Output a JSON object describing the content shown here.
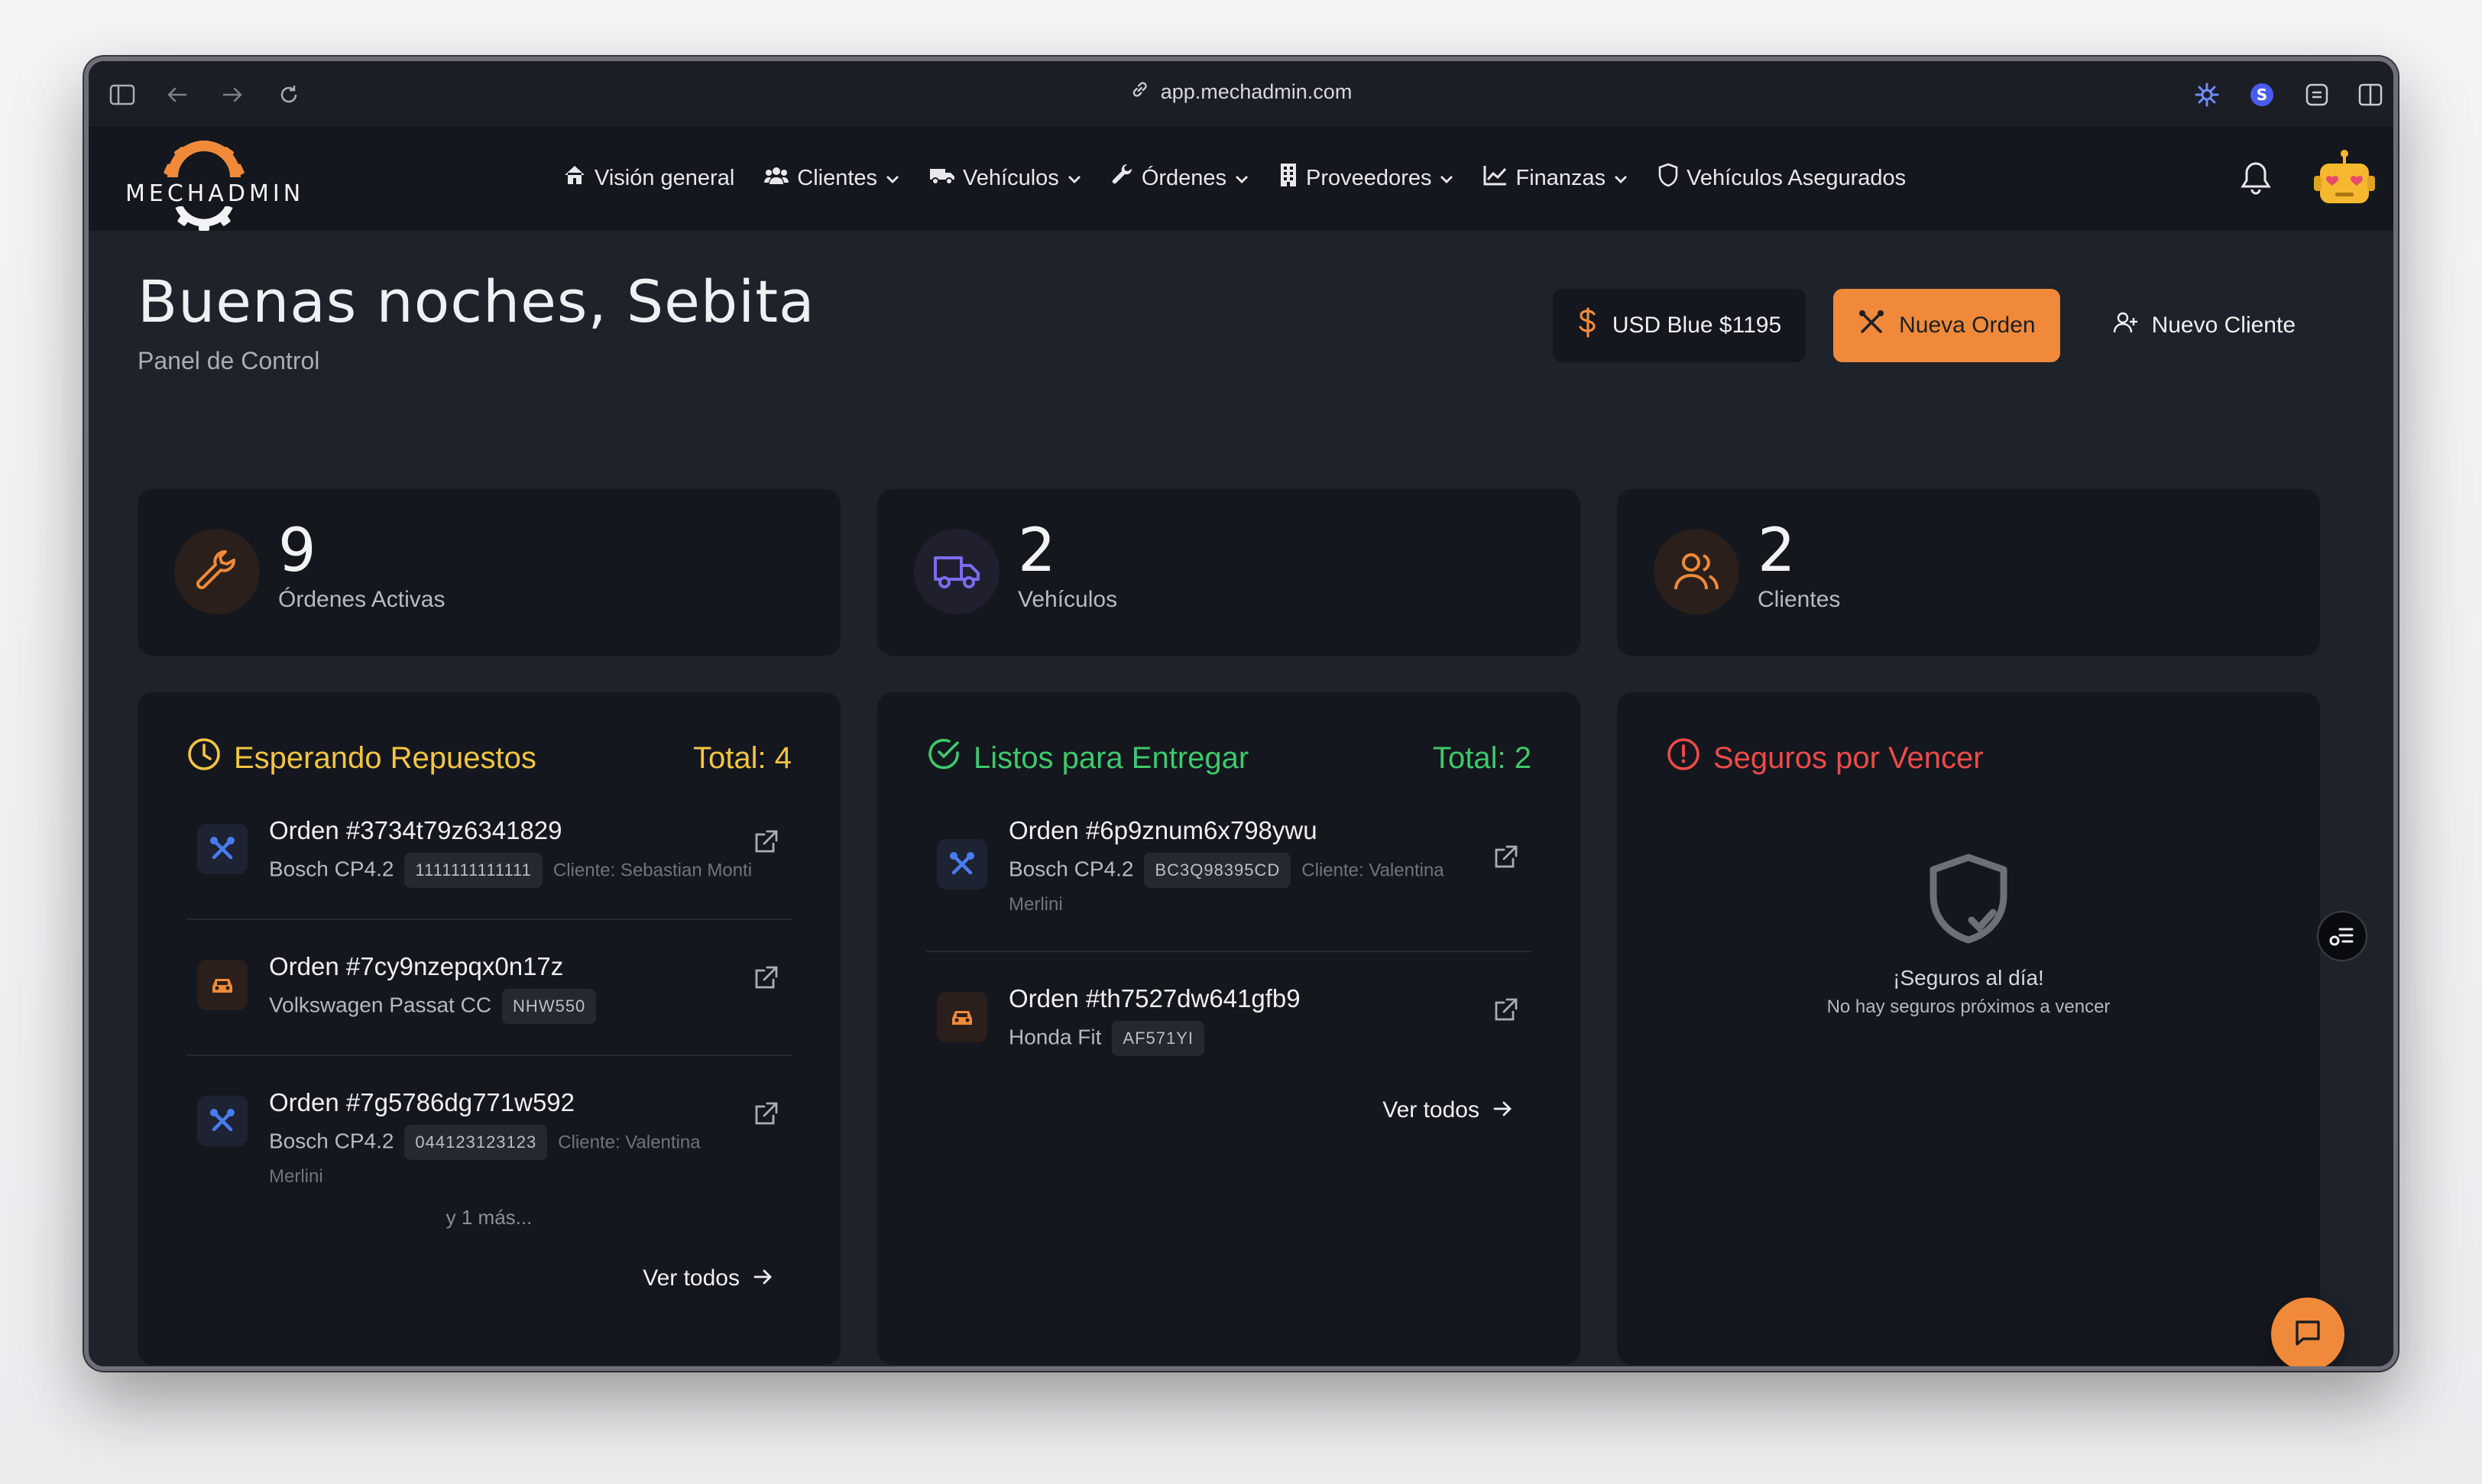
{
  "browser": {
    "url": "app.mechadmin.com",
    "icons": [
      "sidebar-toggle-icon",
      "back-icon",
      "forward-icon",
      "reload-icon",
      "link-icon",
      "extension-icon",
      "profile-icon",
      "extension-2-icon",
      "split-view-icon"
    ]
  },
  "brand": {
    "name": "MECHADMIN"
  },
  "nav": {
    "items": [
      {
        "label": "Visión general",
        "icon": "home-icon",
        "dropdown": false
      },
      {
        "label": "Clientes",
        "icon": "users-icon",
        "dropdown": true
      },
      {
        "label": "Vehículos",
        "icon": "truck-icon",
        "dropdown": true
      },
      {
        "label": "Órdenes",
        "icon": "wrench-icon",
        "dropdown": true
      },
      {
        "label": "Proveedores",
        "icon": "building-icon",
        "dropdown": true
      },
      {
        "label": "Finanzas",
        "icon": "chart-line-icon",
        "dropdown": true
      },
      {
        "label": "Vehículos Asegurados",
        "icon": "shield-icon",
        "dropdown": false
      }
    ]
  },
  "header": {
    "greeting": "Buenas noches, Sebita",
    "subtitle": "Panel de Control",
    "usd_label": "USD Blue $1195",
    "new_order_label": "Nueva Orden",
    "new_client_label": "Nuevo Cliente"
  },
  "stats": [
    {
      "value": "9",
      "label": "Órdenes Activas",
      "color": "#f08a3a"
    },
    {
      "value": "2",
      "label": "Vehículos",
      "color": "#7b6cf0"
    },
    {
      "value": "2",
      "label": "Clientes",
      "color": "#f08a3a"
    }
  ],
  "waiting": {
    "title": "Esperando Repuestos",
    "total": "Total: 4",
    "color": "#f5c542",
    "orders": [
      {
        "title": "Orden #3734t79z6341829",
        "vehicle": "Bosch CP4.2",
        "plate": "1111111111111",
        "client": "Cliente: Sebastian Monti",
        "client2": "",
        "type": "tool"
      },
      {
        "title": "Orden #7cy9nzepqx0n17z",
        "vehicle": "Volkswagen Passat CC",
        "plate": "NHW550",
        "client": "",
        "client2": "",
        "type": "car"
      },
      {
        "title": "Orden #7g5786dg771w592",
        "vehicle": "Bosch CP4.2",
        "plate": "044123123123",
        "client": "Cliente: Valentina",
        "client2": "Merlini",
        "type": "tool"
      }
    ],
    "more": "y 1 más...",
    "ver_todos": "Ver todos"
  },
  "ready": {
    "title": "Listos para Entregar",
    "total": "Total: 2",
    "color": "#3ec96b",
    "orders": [
      {
        "title": "Orden #6p9znum6x798ywu",
        "vehicle": "Bosch CP4.2",
        "plate": "BC3Q98395CD",
        "client": "Cliente: Valentina",
        "client2": "Merlini",
        "type": "tool"
      },
      {
        "title": "Orden #th7527dw641gfb9",
        "vehicle": "Honda Fit",
        "plate": "AF571YI",
        "client": "",
        "client2": "",
        "type": "car"
      }
    ],
    "ver_todos": "Ver todos"
  },
  "insurance": {
    "title": "Seguros por Vencer",
    "color": "#ef4a4a",
    "empty_title": "¡Seguros al día!",
    "empty_sub": "No hay seguros próximos a vencer"
  },
  "colors": {
    "accent": "#f08a3a",
    "tool_icon": "#4a7cf0",
    "car_icon": "#f08a3a"
  }
}
